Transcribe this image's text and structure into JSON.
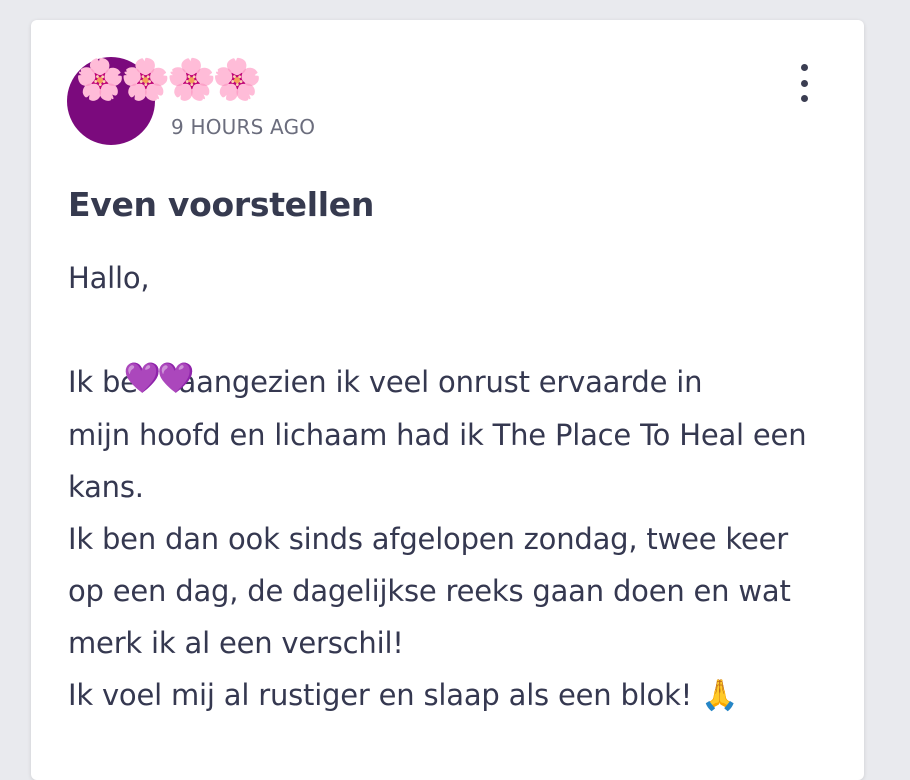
{
  "post": {
    "author_avatar_emoji": "🌸🌸🌸🌸",
    "author_name": "",
    "timestamp": "9 HOURS AGO",
    "title": "Even voorstellen",
    "greeting": "Hallo,",
    "line1_start": "Ik be",
    "line1_hearts": "💜💜",
    "line1_end": "aangezien ik veel onrust ervaarde in",
    "line2": "mijn hoofd en lichaam had ik The Place To Heal een",
    "line3": "kans.",
    "line4": "Ik ben dan ook sinds afgelopen zondag, twee keer",
    "line5": "op een dag, de dagelijkse reeks gaan doen en wat",
    "line6": "merk ik al een verschil!",
    "line7": "Ik voel mij al rustiger en slaap als een blok!",
    "line7_emoji": "🙏"
  },
  "colors": {
    "avatar_bg": "#7b0a7d",
    "text": "#353850",
    "muted": "#6b6d7d"
  },
  "icons": {
    "menu": "more-vertical-icon"
  }
}
